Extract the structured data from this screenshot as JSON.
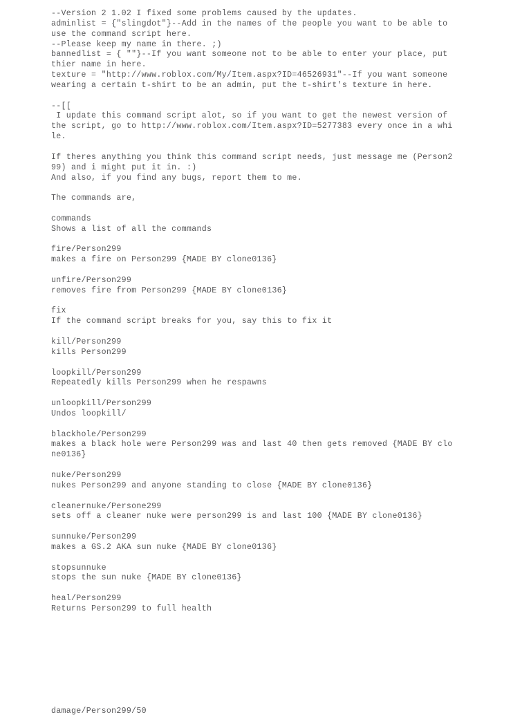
{
  "document": {
    "kind": "plain-text-script-listing",
    "background_color": "#ffffff",
    "text_color": "#58585a",
    "lines": [
      "--Version 2 1.02 I fixed some problems caused by the updates.",
      "adminlist = {\"slingdot\"}--Add in the names of the people you want to be able to",
      "use the command script here.",
      "--Please keep my name in there. ;)",
      "bannedlist = { \"\"}--If you want someone not to be able to enter your place, put",
      "thier name in here.",
      "texture = \"http://www.roblox.com/My/Item.aspx?ID=46526931\"--If you want someone",
      "wearing a certain t-shirt to be an admin, put the t-shirt's texture in here.",
      "",
      "--[[",
      " I update this command script alot, so if you want to get the newest version of",
      "the script, go to http://www.roblox.com/Item.aspx?ID=5277383 every once in a whi",
      "le.",
      "",
      "If theres anything you think this command script needs, just message me (Person2",
      "99) and i might put it in. :)",
      "And also, if you find any bugs, report them to me.",
      "",
      "The commands are,",
      "",
      "commands",
      "Shows a list of all the commands",
      "",
      "fire/Person299",
      "makes a fire on Person299 {MADE BY clone0136}",
      "",
      "unfire/Person299",
      "removes fire from Person299 {MADE BY clone0136}",
      "",
      "fix",
      "If the command script breaks for you, say this to fix it",
      "",
      "kill/Person299",
      "kills Person299",
      "",
      "loopkill/Person299",
      "Repeatedly kills Person299 when he respawns",
      "",
      "unloopkill/Person299",
      "Undos loopkill/",
      "",
      "blackhole/Person299",
      "makes a black hole were Person299 was and last 40 then gets removed {MADE BY clo",
      "ne0136}",
      "",
      "nuke/Person299",
      "nukes Person299 and anyone standing to close {MADE BY clone0136}",
      "",
      "cleanernuke/Persone299",
      "sets off a cleaner nuke were person299 is and last 100 {MADE BY clone0136}",
      "",
      "sunnuke/Person299",
      "makes a GS.2 AKA sun nuke {MADE BY clone0136}",
      "",
      "stopsunnuke",
      "stops the sun nuke {MADE BY clone0136}",
      "",
      "heal/Person299",
      "Returns Person299 to full health",
      "",
      "",
      "",
      "",
      "",
      "",
      "",
      "",
      "",
      "damage/Person299/50"
    ]
  }
}
